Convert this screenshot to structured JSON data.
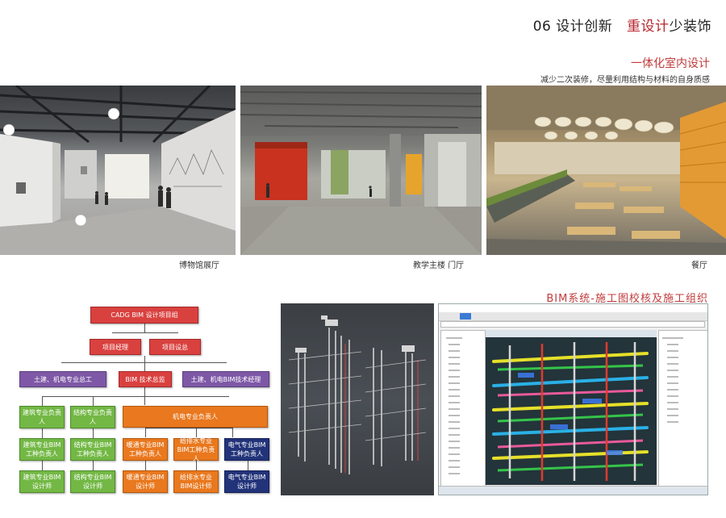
{
  "header": {
    "number": "06",
    "title_part1": "设计创新",
    "title_accent": "重设计",
    "title_part2": "少装饰"
  },
  "section1": {
    "title": "一体化室内设计",
    "subtitle": "减少二次装修，尽量利用结构与材料的自身质感"
  },
  "photos": {
    "museum_caption": "博物馆展厅",
    "lobby_caption": "教学主楼 门厅",
    "canteen_caption": "餐厅"
  },
  "bim": {
    "title": "BIM系统-施工图校核及施工组织"
  },
  "org_chart": {
    "root": "CADG BIM 设计项目组",
    "manager": "项目经理",
    "director": "项目设总",
    "civil_chief": "土建、机电专业总工",
    "bim_director": "BIM 技术总监",
    "bim_manager": "土建、机电BIM技术经理",
    "arch_lead": "建筑专业负责人",
    "struct_lead": "结构专业负责人",
    "mep_lead": "机电专业负责人",
    "arch_bim_lead": "建筑专业BIM工种负责人",
    "struct_bim_lead": "结构专业BIM工种负责人",
    "hvac_bim_lead": "暖通专业BIM工种负责人",
    "plumb_bim_lead": "给排水专业BIM工种负责人",
    "elec_bim_lead": "电气专业BIM工种负责人",
    "arch_designer": "建筑专业BIM设计师",
    "struct_designer": "结构专业BIM设计师",
    "hvac_designer": "暖通专业BIM设计师",
    "plumb_designer": "给排水专业BIM设计师",
    "elec_designer": "电气专业BIM设计师"
  },
  "colors": {
    "accent_red": "#c23a3a",
    "box_red": "#d9413f",
    "box_purple": "#7e58a6",
    "box_green": "#73b845",
    "box_orange": "#e9781e",
    "box_navy": "#22337a"
  }
}
